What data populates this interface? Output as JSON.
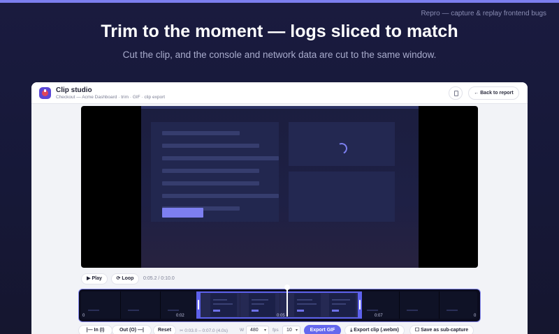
{
  "brand_tag": "Repro — capture & replay frontend bugs",
  "hero": {
    "title": "Trim to the moment — logs sliced to match",
    "subtitle": "Cut the clip, and the console and network data are cut to the same window."
  },
  "window": {
    "title": "Clip studio",
    "breadcrumbs": "Checkout — Acme Dashboard · trim · GIF · clip export",
    "back_label": "← Back to report",
    "icon_button": "clipboard-icon"
  },
  "player": {
    "play_label": "▶ Play",
    "loop_label": "⟳ Loop",
    "time": "0:05.2 / 0:10.0"
  },
  "timeline": {
    "ticks": [
      "0",
      "0:02",
      "0:05",
      "0:07",
      "0"
    ],
    "selection_start_s": 3.0,
    "selection_end_s": 7.0,
    "playhead_s": 5.2,
    "duration_s": 10.0
  },
  "trim_controls": {
    "in_label": "|— In (I)",
    "out_label": "Out (O) —|",
    "reset_label": "Reset",
    "range_text": "✂ 0:03.0 – 0:07.0 (4.0s)",
    "width_label": "W",
    "width_value": "480",
    "fps_label": "fps",
    "fps_value": "10",
    "export_gif_label": "Export GIF",
    "export_clip_label": "⤓ Export clip (.webm)",
    "sub_capture_label": "☐ Save as sub-capture"
  },
  "colors": {
    "accent": "#6468ee",
    "background": "#171937",
    "window": "#f2f3f7"
  }
}
